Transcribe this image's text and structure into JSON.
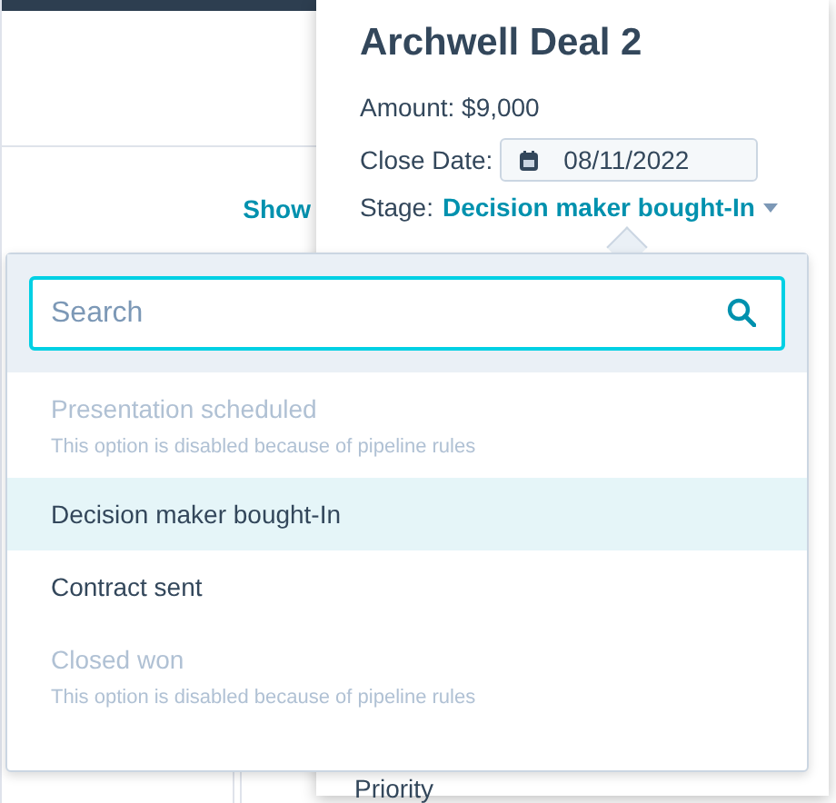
{
  "background": {
    "link": "Show"
  },
  "deal": {
    "title": "Archwell Deal 2",
    "amount": "Amount: $9,000",
    "close_date_label": "Close Date:",
    "close_date": "08/11/2022",
    "stage_label": "Stage:",
    "stage": "Decision maker bought-In",
    "next_label": "Priority"
  },
  "dropdown": {
    "search": {
      "placeholder": "Search"
    },
    "options": [
      {
        "label": "Presentation scheduled",
        "disabled": true,
        "selected": false,
        "help": "This option is disabled because of pipeline rules"
      },
      {
        "label": "Decision maker bought-In",
        "disabled": false,
        "selected": true
      },
      {
        "label": "Contract sent",
        "disabled": false,
        "selected": false
      },
      {
        "label": "Closed won",
        "disabled": true,
        "selected": false,
        "help": "This option is disabled because of pipeline rules"
      }
    ]
  }
}
